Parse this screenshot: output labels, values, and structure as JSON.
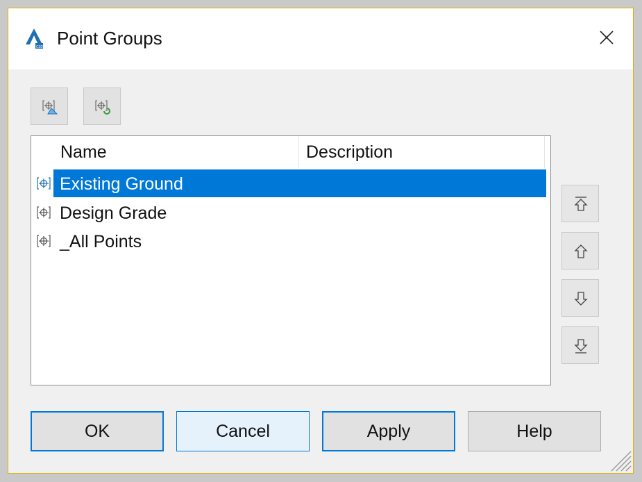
{
  "window": {
    "title": "Point Groups"
  },
  "toolbar": [
    {
      "icon": "point-group-properties-icon"
    },
    {
      "icon": "update-point-groups-icon"
    }
  ],
  "list": {
    "columns": [
      "Name",
      "Description"
    ],
    "rows": [
      {
        "name": "Existing Ground",
        "description": "",
        "selected": true
      },
      {
        "name": "Design Grade",
        "description": "",
        "selected": false
      },
      {
        "name": "_All Points",
        "description": "",
        "selected": false
      }
    ]
  },
  "side_buttons": [
    "move-to-top-icon",
    "move-up-icon",
    "move-down-icon",
    "move-to-bottom-icon"
  ],
  "buttons": {
    "ok": "OK",
    "cancel": "Cancel",
    "apply": "Apply",
    "help": "Help"
  },
  "colors": {
    "selection": "#0078d7",
    "default_border": "#0078d7",
    "window_border": "#e0b100"
  }
}
